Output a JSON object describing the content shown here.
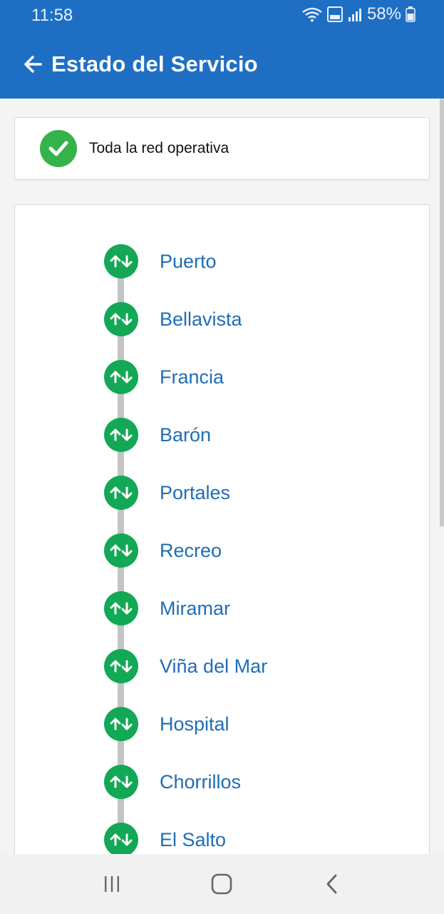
{
  "status_bar": {
    "time": "11:58",
    "battery": "58%"
  },
  "header": {
    "title": "Estado del Servicio"
  },
  "network_status": {
    "text": "Toda la red operativa",
    "color": "#36b24a"
  },
  "stations": [
    {
      "name": "Puerto",
      "status": "operativa"
    },
    {
      "name": "Bellavista",
      "status": "operativa"
    },
    {
      "name": "Francia",
      "status": "operativa"
    },
    {
      "name": "Barón",
      "status": "operativa"
    },
    {
      "name": "Portales",
      "status": "operativa"
    },
    {
      "name": "Recreo",
      "status": "operativa"
    },
    {
      "name": "Miramar",
      "status": "operativa"
    },
    {
      "name": "Viña del Mar",
      "status": "operativa"
    },
    {
      "name": "Hospital",
      "status": "operativa"
    },
    {
      "name": "Chorrillos",
      "status": "operativa"
    },
    {
      "name": "El Salto",
      "status": "operativa"
    }
  ],
  "icons": {
    "station": "up-down-arrows-icon",
    "back": "arrow-left-icon",
    "nav": [
      "recents-icon",
      "home-icon",
      "back-icon"
    ]
  },
  "colors": {
    "primary": "#1e6fc4",
    "station_ok": "#12a855",
    "link": "#1f6db5"
  }
}
